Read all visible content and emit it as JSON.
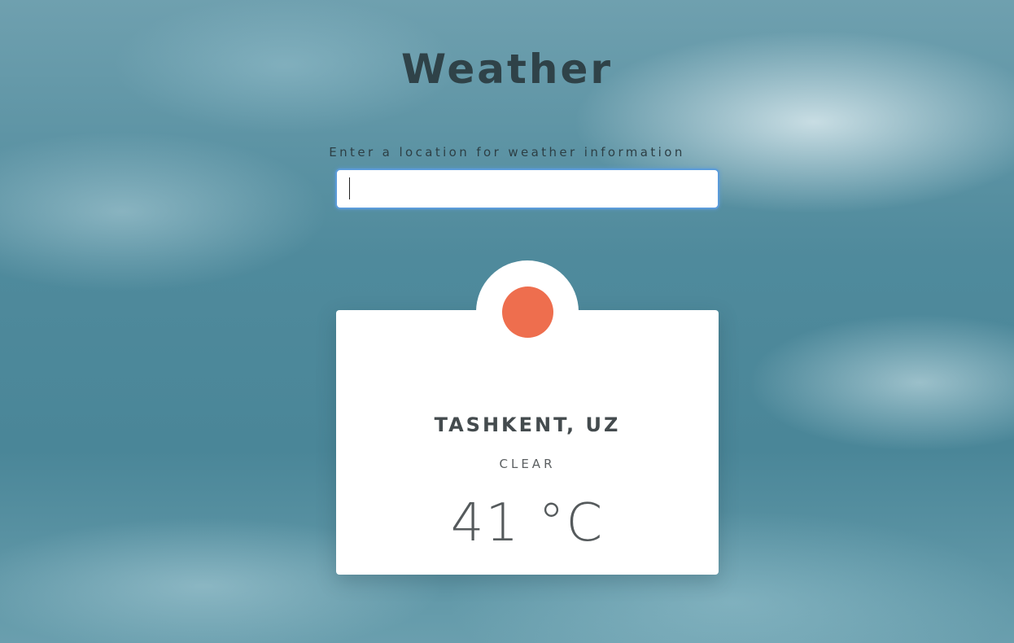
{
  "app": {
    "title": "Weather"
  },
  "search": {
    "prompt": "Enter a location for weather information",
    "value": "",
    "placeholder": ""
  },
  "weather": {
    "icon": "sun-icon",
    "location": "TASHKENT, UZ",
    "condition": "CLEAR",
    "temperature": "41 °C"
  },
  "colors": {
    "accent": "#ee6e4e",
    "input_focus": "#5b9bd9"
  }
}
